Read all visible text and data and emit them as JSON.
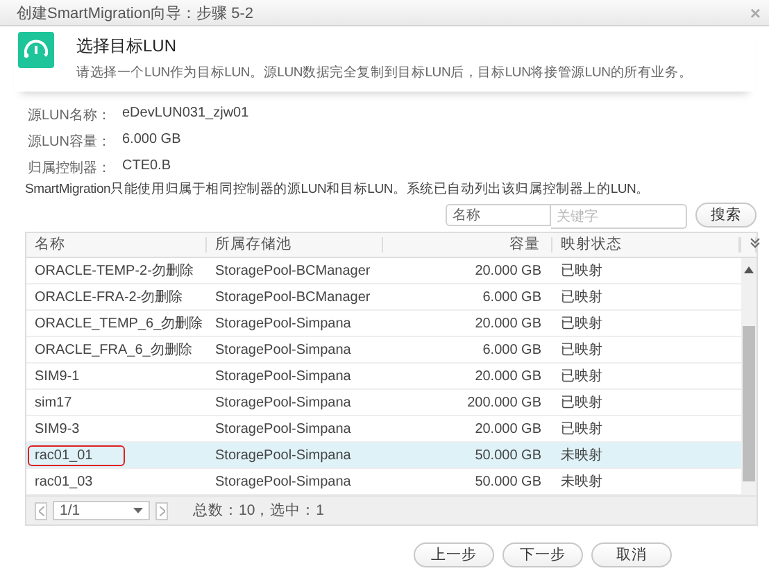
{
  "window": {
    "title": "创建SmartMigration向导：步骤 5-2",
    "close": "×"
  },
  "header": {
    "title": "选择目标LUN",
    "description": "请选择一个LUN作为目标LUN。源LUN数据完全复制到目标LUN后，目标LUN将接管源LUN的所有业务。"
  },
  "info": [
    {
      "label": "源LUN名称：",
      "value": "eDevLUN031_zjw01"
    },
    {
      "label": "源LUN容量：",
      "value": "6.000 GB"
    },
    {
      "label": "归属控制器：",
      "value": "CTE0.B"
    }
  ],
  "note": "SmartMigration只能使用归属于相同控制器的源LUN和目标LUN。系统已自动列出该归属控制器上的LUN。",
  "search": {
    "field": "名称",
    "placeholder": "关键字",
    "button": "搜索"
  },
  "table": {
    "columns": [
      "名称",
      "所属存储池",
      "容量",
      "映射状态"
    ],
    "rows": [
      {
        "name": "ORACLE-TEMP-2-勿删除",
        "pool": "StoragePool-BCManager",
        "capacity": "20.000 GB",
        "status": "已映射",
        "selected": false,
        "annotated": false
      },
      {
        "name": "ORACLE-FRA-2-勿删除",
        "pool": "StoragePool-BCManager",
        "capacity": "6.000 GB",
        "status": "已映射",
        "selected": false,
        "annotated": false
      },
      {
        "name": "ORACLE_TEMP_6_勿删除",
        "pool": "StoragePool-Simpana",
        "capacity": "20.000 GB",
        "status": "已映射",
        "selected": false,
        "annotated": false
      },
      {
        "name": "ORACLE_FRA_6_勿删除",
        "pool": "StoragePool-Simpana",
        "capacity": "6.000 GB",
        "status": "已映射",
        "selected": false,
        "annotated": false
      },
      {
        "name": "SIM9-1",
        "pool": "StoragePool-Simpana",
        "capacity": "20.000 GB",
        "status": "已映射",
        "selected": false,
        "annotated": false
      },
      {
        "name": "sim17",
        "pool": "StoragePool-Simpana",
        "capacity": "200.000 GB",
        "status": "已映射",
        "selected": false,
        "annotated": false
      },
      {
        "name": "SIM9-3",
        "pool": "StoragePool-Simpana",
        "capacity": "20.000 GB",
        "status": "已映射",
        "selected": false,
        "annotated": false
      },
      {
        "name": "rac01_01",
        "pool": "StoragePool-Simpana",
        "capacity": "50.000 GB",
        "status": "未映射",
        "selected": true,
        "annotated": true
      },
      {
        "name": "rac01_03",
        "pool": "StoragePool-Simpana",
        "capacity": "50.000 GB",
        "status": "未映射",
        "selected": false,
        "annotated": false
      }
    ],
    "pager": {
      "page": "1/1",
      "summary": "总数：10，选中：1"
    }
  },
  "buttons": [
    "上一步",
    "下一步",
    "取消"
  ]
}
